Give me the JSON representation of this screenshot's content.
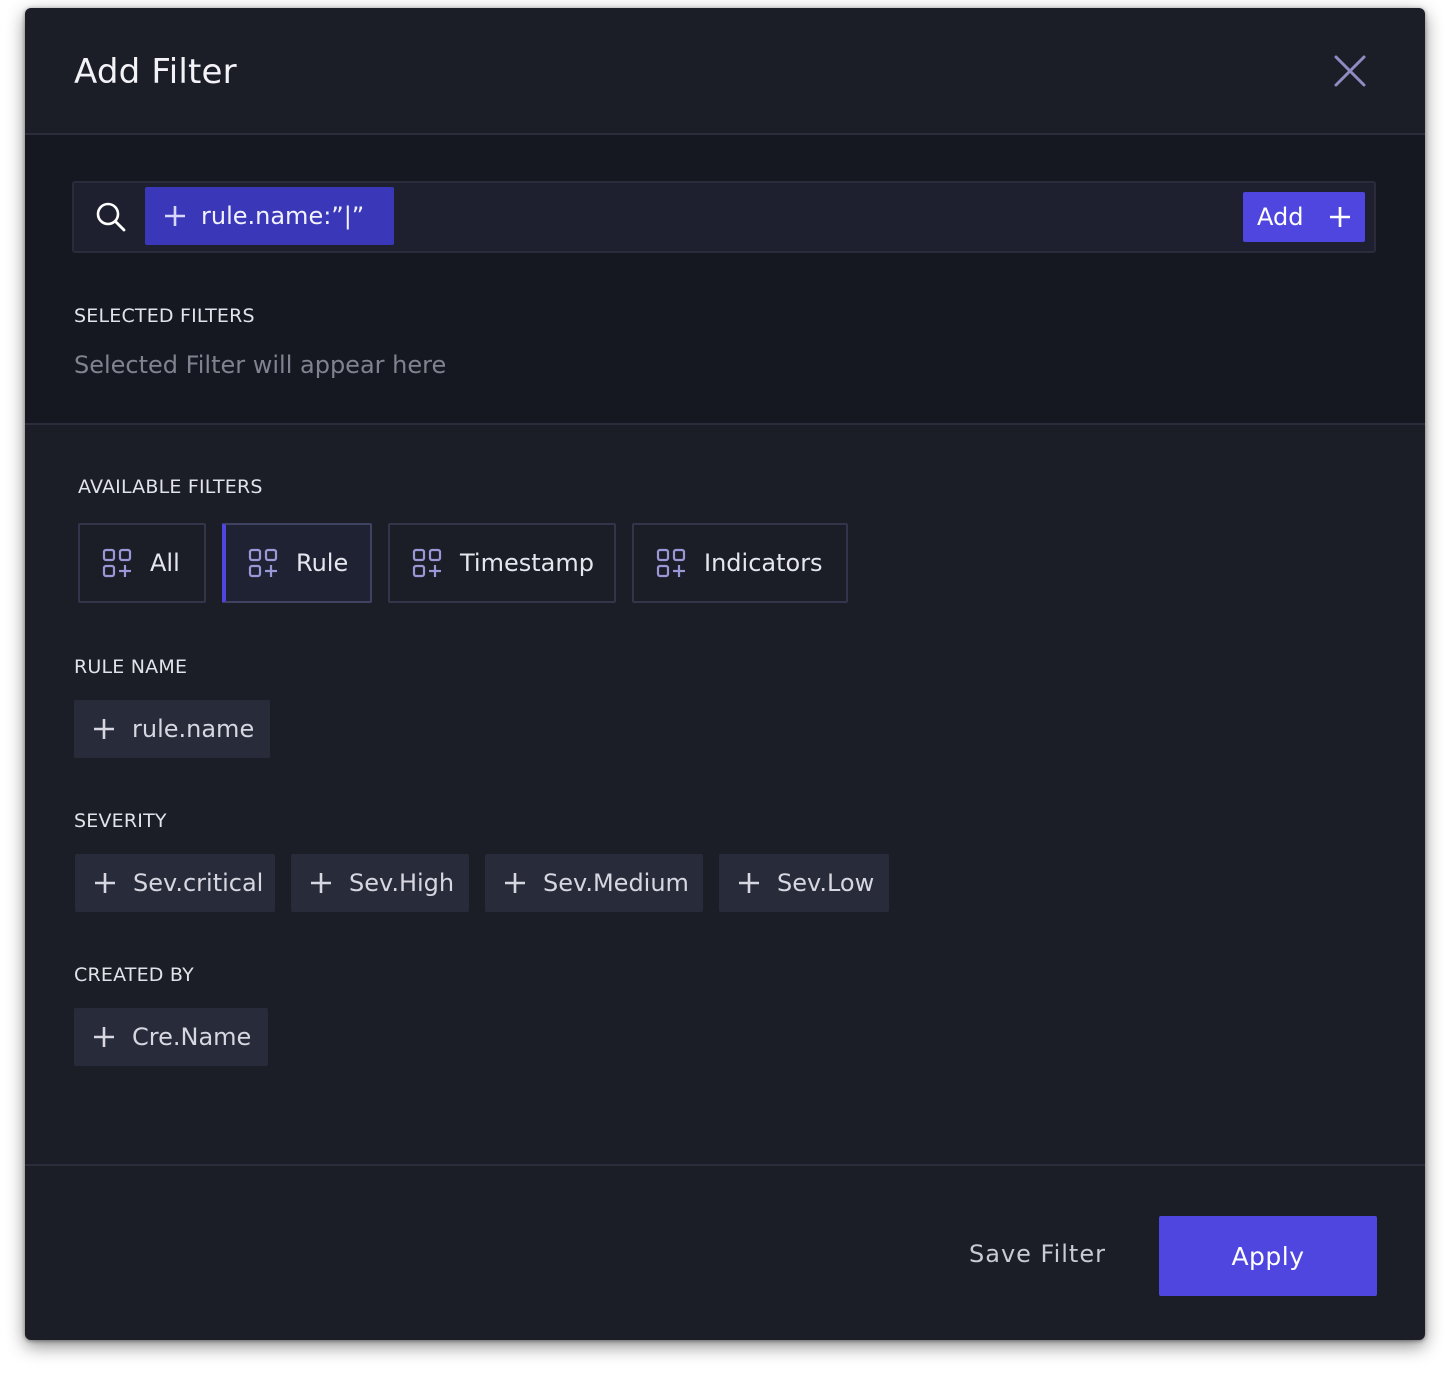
{
  "dialog": {
    "title": "Add Filter",
    "close_icon": "close-icon"
  },
  "search": {
    "icon": "search-icon",
    "chip_label": "rule.name:”|”",
    "add_label": "Add"
  },
  "selected_filters": {
    "heading": "SELECTED FILTERS",
    "placeholder": "Selected Filter will appear here"
  },
  "available_filters": {
    "heading": "AVAILABLE FILTERS",
    "tabs": [
      {
        "label": "All",
        "active": false
      },
      {
        "label": "Rule",
        "active": true
      },
      {
        "label": "Timestamp",
        "active": false
      },
      {
        "label": "Indicators",
        "active": false
      }
    ]
  },
  "rule_name": {
    "heading": "RULE NAME",
    "chips": [
      "rule.name"
    ]
  },
  "severity": {
    "heading": "SEVERITY",
    "chips": [
      "Sev.critical",
      "Sev.High",
      "Sev.Medium",
      "Sev.Low"
    ]
  },
  "created_by": {
    "heading": "CREATED BY",
    "chips": [
      "Cre.Name"
    ]
  },
  "footer": {
    "save_label": "Save Filter",
    "apply_label": "Apply"
  },
  "colors": {
    "accent": "#4f46e0",
    "background": "#1b1d27"
  }
}
